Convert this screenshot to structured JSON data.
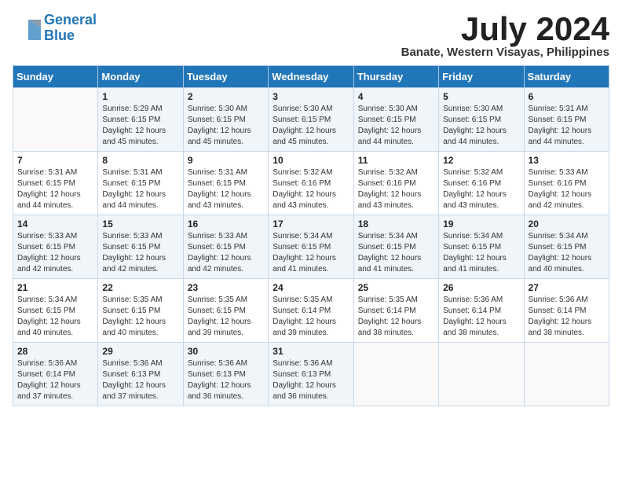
{
  "logo": {
    "line1": "General",
    "line2": "Blue"
  },
  "title": "July 2024",
  "location": "Banate, Western Visayas, Philippines",
  "header": {
    "days": [
      "Sunday",
      "Monday",
      "Tuesday",
      "Wednesday",
      "Thursday",
      "Friday",
      "Saturday"
    ]
  },
  "weeks": [
    [
      {
        "day": "",
        "content": ""
      },
      {
        "day": "1",
        "content": "Sunrise: 5:29 AM\nSunset: 6:15 PM\nDaylight: 12 hours\nand 45 minutes."
      },
      {
        "day": "2",
        "content": "Sunrise: 5:30 AM\nSunset: 6:15 PM\nDaylight: 12 hours\nand 45 minutes."
      },
      {
        "day": "3",
        "content": "Sunrise: 5:30 AM\nSunset: 6:15 PM\nDaylight: 12 hours\nand 45 minutes."
      },
      {
        "day": "4",
        "content": "Sunrise: 5:30 AM\nSunset: 6:15 PM\nDaylight: 12 hours\nand 44 minutes."
      },
      {
        "day": "5",
        "content": "Sunrise: 5:30 AM\nSunset: 6:15 PM\nDaylight: 12 hours\nand 44 minutes."
      },
      {
        "day": "6",
        "content": "Sunrise: 5:31 AM\nSunset: 6:15 PM\nDaylight: 12 hours\nand 44 minutes."
      }
    ],
    [
      {
        "day": "7",
        "content": "Sunrise: 5:31 AM\nSunset: 6:15 PM\nDaylight: 12 hours\nand 44 minutes."
      },
      {
        "day": "8",
        "content": "Sunrise: 5:31 AM\nSunset: 6:15 PM\nDaylight: 12 hours\nand 44 minutes."
      },
      {
        "day": "9",
        "content": "Sunrise: 5:31 AM\nSunset: 6:15 PM\nDaylight: 12 hours\nand 43 minutes."
      },
      {
        "day": "10",
        "content": "Sunrise: 5:32 AM\nSunset: 6:16 PM\nDaylight: 12 hours\nand 43 minutes."
      },
      {
        "day": "11",
        "content": "Sunrise: 5:32 AM\nSunset: 6:16 PM\nDaylight: 12 hours\nand 43 minutes."
      },
      {
        "day": "12",
        "content": "Sunrise: 5:32 AM\nSunset: 6:16 PM\nDaylight: 12 hours\nand 43 minutes."
      },
      {
        "day": "13",
        "content": "Sunrise: 5:33 AM\nSunset: 6:16 PM\nDaylight: 12 hours\nand 42 minutes."
      }
    ],
    [
      {
        "day": "14",
        "content": "Sunrise: 5:33 AM\nSunset: 6:15 PM\nDaylight: 12 hours\nand 42 minutes."
      },
      {
        "day": "15",
        "content": "Sunrise: 5:33 AM\nSunset: 6:15 PM\nDaylight: 12 hours\nand 42 minutes."
      },
      {
        "day": "16",
        "content": "Sunrise: 5:33 AM\nSunset: 6:15 PM\nDaylight: 12 hours\nand 42 minutes."
      },
      {
        "day": "17",
        "content": "Sunrise: 5:34 AM\nSunset: 6:15 PM\nDaylight: 12 hours\nand 41 minutes."
      },
      {
        "day": "18",
        "content": "Sunrise: 5:34 AM\nSunset: 6:15 PM\nDaylight: 12 hours\nand 41 minutes."
      },
      {
        "day": "19",
        "content": "Sunrise: 5:34 AM\nSunset: 6:15 PM\nDaylight: 12 hours\nand 41 minutes."
      },
      {
        "day": "20",
        "content": "Sunrise: 5:34 AM\nSunset: 6:15 PM\nDaylight: 12 hours\nand 40 minutes."
      }
    ],
    [
      {
        "day": "21",
        "content": "Sunrise: 5:34 AM\nSunset: 6:15 PM\nDaylight: 12 hours\nand 40 minutes."
      },
      {
        "day": "22",
        "content": "Sunrise: 5:35 AM\nSunset: 6:15 PM\nDaylight: 12 hours\nand 40 minutes."
      },
      {
        "day": "23",
        "content": "Sunrise: 5:35 AM\nSunset: 6:15 PM\nDaylight: 12 hours\nand 39 minutes."
      },
      {
        "day": "24",
        "content": "Sunrise: 5:35 AM\nSunset: 6:14 PM\nDaylight: 12 hours\nand 39 minutes."
      },
      {
        "day": "25",
        "content": "Sunrise: 5:35 AM\nSunset: 6:14 PM\nDaylight: 12 hours\nand 38 minutes."
      },
      {
        "day": "26",
        "content": "Sunrise: 5:36 AM\nSunset: 6:14 PM\nDaylight: 12 hours\nand 38 minutes."
      },
      {
        "day": "27",
        "content": "Sunrise: 5:36 AM\nSunset: 6:14 PM\nDaylight: 12 hours\nand 38 minutes."
      }
    ],
    [
      {
        "day": "28",
        "content": "Sunrise: 5:36 AM\nSunset: 6:14 PM\nDaylight: 12 hours\nand 37 minutes."
      },
      {
        "day": "29",
        "content": "Sunrise: 5:36 AM\nSunset: 6:13 PM\nDaylight: 12 hours\nand 37 minutes."
      },
      {
        "day": "30",
        "content": "Sunrise: 5:36 AM\nSunset: 6:13 PM\nDaylight: 12 hours\nand 36 minutes."
      },
      {
        "day": "31",
        "content": "Sunrise: 5:36 AM\nSunset: 6:13 PM\nDaylight: 12 hours\nand 36 minutes."
      },
      {
        "day": "",
        "content": ""
      },
      {
        "day": "",
        "content": ""
      },
      {
        "day": "",
        "content": ""
      }
    ]
  ]
}
